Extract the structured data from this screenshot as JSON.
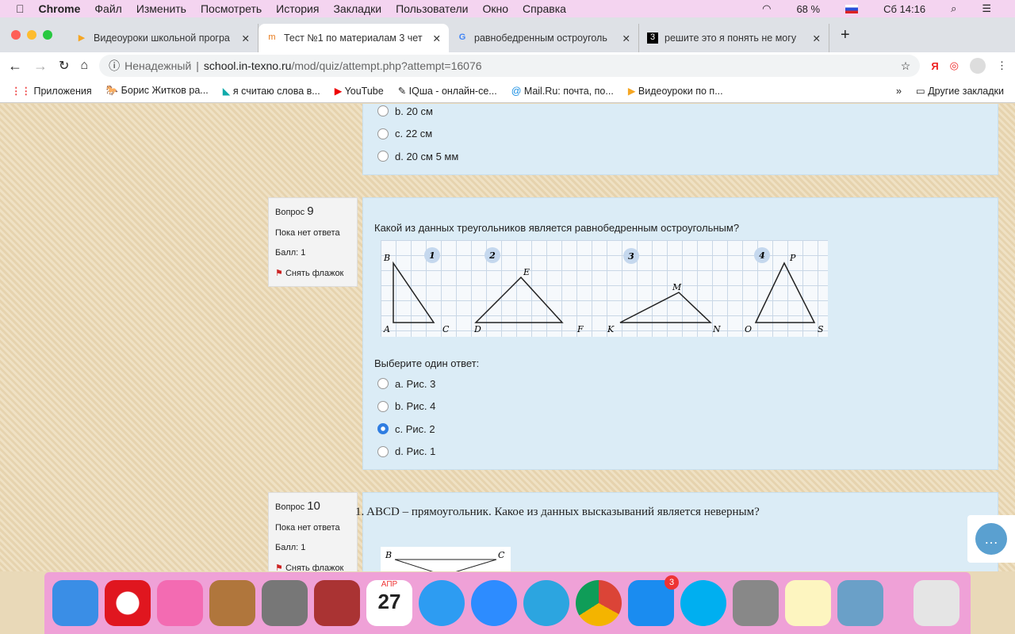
{
  "menubar": {
    "app": "Chrome",
    "items": [
      "Файл",
      "Изменить",
      "Посмотреть",
      "История",
      "Закладки",
      "Пользователи",
      "Окно",
      "Справка"
    ],
    "battery": "68 %",
    "clock": "Сб 14:16"
  },
  "tabs": [
    {
      "label": "Видеоуроки школьной програ"
    },
    {
      "label": "Тест №1 по материалам 3 чет"
    },
    {
      "label": "равнобедренным остроуголь"
    },
    {
      "label": "решите это я понять не могу"
    }
  ],
  "address": {
    "security": "Ненадежный",
    "host": "school.in-texno.ru",
    "path": "/mod/quiz/attempt.php?attempt=16076"
  },
  "bookmarks": [
    "Приложения",
    "Борис Житков ра...",
    "я считаю слова в...",
    "YouTube",
    "IQша - онлайн-се...",
    "Mail.Ru: почта, по...",
    "Видеоуроки по п..."
  ],
  "other_bookmarks": "Другие закладки",
  "prev_question": {
    "options": [
      "b. 20 см",
      "c. 22 см",
      "d. 20 см 5 мм"
    ]
  },
  "q9": {
    "label": "Вопрос",
    "number": "9",
    "status": "Пока нет ответа",
    "score": "Балл: 1",
    "flag": "Снять флажок",
    "text": "Какой из данных треугольников является равнобедренным остроугольным?",
    "prompt": "Выберите один ответ:",
    "options": [
      "a. Рис. 3",
      "b. Рис. 4",
      "c. Рис. 2",
      "d. Рис. 1"
    ],
    "selected": 2,
    "figure": {
      "numbers": [
        "1",
        "2",
        "3",
        "4"
      ],
      "labels": [
        "B",
        "A",
        "C",
        "E",
        "D",
        "F",
        "M",
        "K",
        "N",
        "P",
        "O",
        "S"
      ]
    }
  },
  "q10": {
    "label": "Вопрос",
    "number": "10",
    "status": "Пока нет ответа",
    "score": "Балл: 1",
    "flag": "Снять флажок",
    "text": "1.   ABCD – прямоугольник. Какое из данных высказываний является неверным?",
    "fig_labels": [
      "B",
      "C"
    ]
  },
  "dock": {
    "badge": "3",
    "calendar_month": "АПР",
    "calendar_day": "27"
  }
}
